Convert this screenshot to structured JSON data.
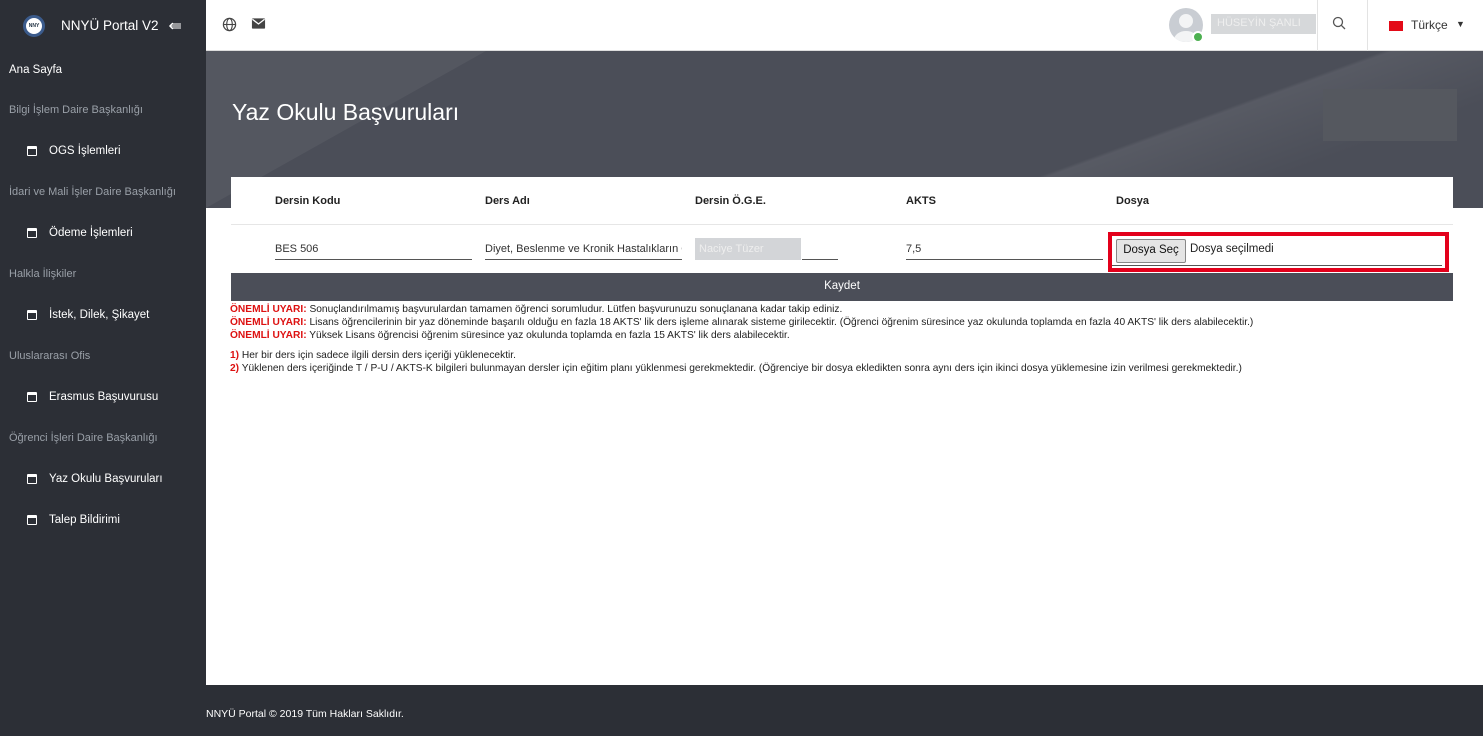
{
  "sidebar": {
    "brand_title": "NNYÜ Portal V2",
    "toggle_icon": "arrow-left-icon",
    "items": [
      {
        "type": "link-top",
        "label": "Ana Sayfa"
      },
      {
        "type": "heading",
        "label": "Bilgi İşlem Daire Başkanlığı"
      },
      {
        "type": "link",
        "label": "OGS İşlemleri"
      },
      {
        "type": "heading",
        "label": "İdari ve Mali İşler Daire Başkanlığı"
      },
      {
        "type": "link",
        "label": "Ödeme İşlemleri"
      },
      {
        "type": "heading",
        "label": "Halkla İlişkiler"
      },
      {
        "type": "link",
        "label": "İstek, Dilek, Şikayet"
      },
      {
        "type": "heading",
        "label": "Uluslararası Ofis"
      },
      {
        "type": "link",
        "label": "Erasmus Başuvurusu"
      },
      {
        "type": "heading",
        "label": "Öğrenci İşleri Daire Başkanlığı"
      },
      {
        "type": "link",
        "label": "Yaz Okulu Başvuruları"
      },
      {
        "type": "link",
        "label": "Talep Bildirimi"
      }
    ]
  },
  "topbar": {
    "user_name": "HÜSEYİN ŞANLI",
    "language": "Türkçe"
  },
  "page": {
    "title": "Yaz Okulu Başvuruları"
  },
  "table": {
    "headers": [
      "Dersin Kodu",
      "Ders Adı",
      "Dersin Ö.G.E.",
      "AKTS",
      "Dosya"
    ],
    "row": {
      "code": "BES 506",
      "name": "Diyet, Beslenme ve Kronik Hastalıkların Önlenmesi",
      "oge": "Naciye Tüzer",
      "akts": "7,5",
      "file_button": "Dosya Seç",
      "file_status": "Dosya seçilmedi"
    },
    "save_label": "Kaydet"
  },
  "notes": {
    "warning_prefix": "ÖNEMLİ UYARI:",
    "warnings": [
      "Sonuçlandırılmamış başvurulardan tamamen öğrenci sorumludur. Lütfen başvurunuzu sonuçlanana kadar takip ediniz.",
      "Lisans öğrencilerinin bir yaz döneminde başarılı olduğu en fazla 18 AKTS' lik ders işleme alınarak sisteme girilecektir. (Öğrenci öğrenim süresince yaz okulunda toplamda en fazla 40 AKTS' lik ders alabilecektir.)",
      "Yüksek Lisans öğrencisi öğrenim süresince yaz okulunda toplamda en fazla 15 AKTS' lik ders alabilecektir."
    ],
    "items": [
      {
        "num": "1)",
        "text": "Her bir ders için sadece ilgili dersin ders içeriği yüklenecektir."
      },
      {
        "num": "2)",
        "text": "Yüklenen ders içeriğinde T / P-U / AKTS-K bilgileri bulunmayan dersler için eğitim planı yüklenmesi gerekmektedir. (Öğrenciye bir dosya ekledikten sonra aynı ders için ikinci dosya yüklemesine izin verilmesi gerekmektedir.)"
      }
    ]
  },
  "footer": {
    "text": "NNYÜ Portal © 2019 Tüm Hakları Saklıdır."
  }
}
